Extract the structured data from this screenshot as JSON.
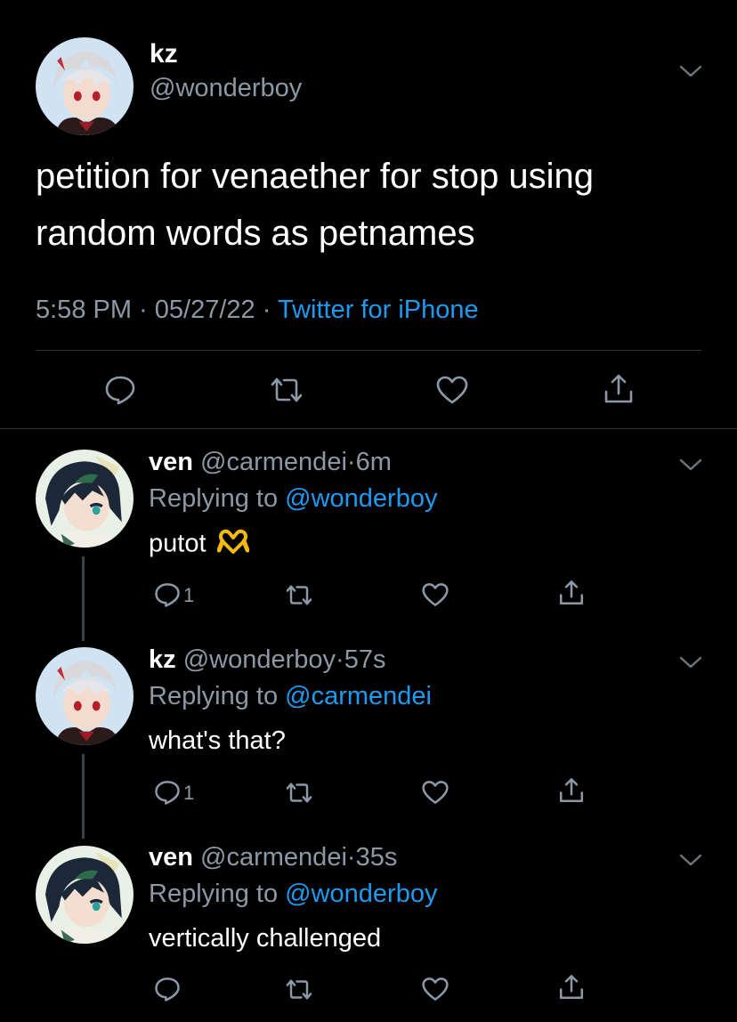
{
  "main_tweet": {
    "name": "kz",
    "handle": "@wonderboy",
    "text": "petition for venaether for stop using random words as petnames",
    "time": "5:58 PM",
    "separator": "·",
    "date": "05/27/22",
    "source": "Twitter for iPhone"
  },
  "replies": [
    {
      "name": "ven",
      "handle": "@carmendei",
      "dot": "·",
      "time": "6m",
      "replying_prefix": "Replying to",
      "replying_to": "@wonderboy",
      "text": "putot",
      "emoji": "🫶",
      "reply_count": "1"
    },
    {
      "name": "kz",
      "handle": "@wonderboy",
      "dot": "·",
      "time": "57s",
      "replying_prefix": "Replying to",
      "replying_to": "@carmendei",
      "text": "what's that?",
      "reply_count": "1"
    },
    {
      "name": "ven",
      "handle": "@carmendei",
      "dot": "·",
      "time": "35s",
      "replying_prefix": "Replying to",
      "replying_to": "@wonderboy",
      "text": "vertically challenged",
      "reply_count": ""
    }
  ],
  "icons": {
    "reply": "reply-icon",
    "retweet": "retweet-icon",
    "like": "heart-icon",
    "share": "share-icon",
    "more": "chevron-down-icon"
  },
  "colors": {
    "background": "#000000",
    "primary_text": "#ffffff",
    "secondary_text": "#8b98a5",
    "link": "#1d9bf0",
    "divider": "#2f3336"
  }
}
